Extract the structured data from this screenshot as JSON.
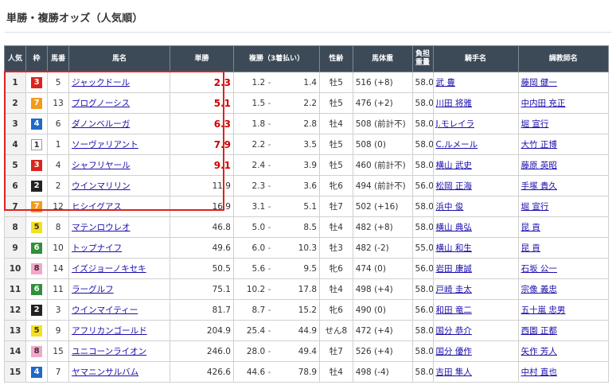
{
  "title": "単勝・複勝オッズ（人気順）",
  "columns": [
    "人気",
    "枠",
    "馬番",
    "馬名",
    "単勝",
    "複勝（3着払い）",
    "性齢",
    "馬体重",
    "負担重量",
    "騎手名",
    "調教師名"
  ],
  "waku_colors": {
    "1": {
      "bg": "#ffffff",
      "fg": "#333333"
    },
    "2": {
      "bg": "#222222",
      "fg": "#ffffff"
    },
    "3": {
      "bg": "#d9251c",
      "fg": "#ffffff"
    },
    "4": {
      "bg": "#1f6ac9",
      "fg": "#ffffff"
    },
    "5": {
      "bg": "#f5e020",
      "fg": "#333333"
    },
    "6": {
      "bg": "#2f8f3a",
      "fg": "#ffffff"
    },
    "7": {
      "bg": "#f39a1c",
      "fg": "#ffffff"
    },
    "8": {
      "bg": "#f4a6c8",
      "fg": "#333333"
    }
  },
  "highlight_color": "#e02020",
  "rows": [
    {
      "pop": "1",
      "waku": "3",
      "umaban": "5",
      "name": "ジャックドール",
      "win": "2.3",
      "win_red": true,
      "place_lo": "1.2",
      "place_hi": "1.4",
      "sexage": "牡5",
      "weight": "516 (+8)",
      "load": "58.0",
      "jockey": "武 豊",
      "trainer": "藤岡 健一"
    },
    {
      "pop": "2",
      "waku": "7",
      "umaban": "13",
      "name": "プログノーシス",
      "win": "5.1",
      "win_red": true,
      "place_lo": "1.5",
      "place_hi": "2.2",
      "sexage": "牡5",
      "weight": "476 (+2)",
      "load": "58.0",
      "jockey": "川田 将雅",
      "trainer": "中内田 充正"
    },
    {
      "pop": "3",
      "waku": "4",
      "umaban": "6",
      "name": "ダノンベルーガ",
      "win": "6.3",
      "win_red": true,
      "place_lo": "1.8",
      "place_hi": "2.8",
      "sexage": "牡4",
      "weight": "508 (前計不)",
      "load": "58.0",
      "jockey": "J.モレイラ",
      "trainer": "堀 宣行"
    },
    {
      "pop": "4",
      "waku": "1",
      "umaban": "1",
      "name": "ソーヴァリアント",
      "win": "7.9",
      "win_red": true,
      "place_lo": "2.2",
      "place_hi": "3.5",
      "sexage": "牡5",
      "weight": "508 (0)",
      "load": "58.0",
      "jockey": "C.ルメール",
      "trainer": "大竹 正博"
    },
    {
      "pop": "5",
      "waku": "3",
      "umaban": "4",
      "name": "シャフリヤール",
      "win": "9.1",
      "win_red": true,
      "place_lo": "2.4",
      "place_hi": "3.9",
      "sexage": "牡5",
      "weight": "460 (前計不)",
      "load": "58.0",
      "jockey": "横山 武史",
      "trainer": "藤原 英昭"
    },
    {
      "pop": "6",
      "waku": "2",
      "umaban": "2",
      "name": "ウインマリリン",
      "win": "11.9",
      "win_red": false,
      "place_lo": "2.3",
      "place_hi": "3.6",
      "sexage": "牝6",
      "weight": "494 (前計不)",
      "load": "56.0",
      "jockey": "松岡 正海",
      "trainer": "手塚 貴久"
    },
    {
      "pop": "7",
      "waku": "7",
      "umaban": "12",
      "name": "ヒシイグアス",
      "win": "16.9",
      "win_red": false,
      "place_lo": "3.1",
      "place_hi": "5.1",
      "sexage": "牡7",
      "weight": "502 (+16)",
      "load": "58.0",
      "jockey": "浜中 俊",
      "trainer": "堀 宣行"
    },
    {
      "pop": "8",
      "waku": "5",
      "umaban": "8",
      "name": "マテンロウレオ",
      "win": "46.8",
      "win_red": false,
      "place_lo": "5.0",
      "place_hi": "8.5",
      "sexage": "牡4",
      "weight": "482 (+8)",
      "load": "58.0",
      "jockey": "横山 典弘",
      "trainer": "昆 貢"
    },
    {
      "pop": "9",
      "waku": "6",
      "umaban": "10",
      "name": "トップナイフ",
      "win": "49.6",
      "win_red": false,
      "place_lo": "6.0",
      "place_hi": "10.3",
      "sexage": "牡3",
      "weight": "482 (-2)",
      "load": "55.0",
      "jockey": "横山 和生",
      "trainer": "昆 貢"
    },
    {
      "pop": "10",
      "waku": "8",
      "umaban": "14",
      "name": "イズジョーノキセキ",
      "win": "50.5",
      "win_red": false,
      "place_lo": "5.6",
      "place_hi": "9.5",
      "sexage": "牝6",
      "weight": "474 (0)",
      "load": "56.0",
      "jockey": "岩田 康誠",
      "trainer": "石坂 公一"
    },
    {
      "pop": "11",
      "waku": "6",
      "umaban": "11",
      "name": "ラーグルフ",
      "win": "75.1",
      "win_red": false,
      "place_lo": "10.2",
      "place_hi": "17.8",
      "sexage": "牡4",
      "weight": "498 (+4)",
      "load": "58.0",
      "jockey": "戸崎 圭太",
      "trainer": "宗像 義忠"
    },
    {
      "pop": "12",
      "waku": "2",
      "umaban": "3",
      "name": "ウインマイティー",
      "win": "81.7",
      "win_red": false,
      "place_lo": "8.7",
      "place_hi": "15.2",
      "sexage": "牝6",
      "weight": "490 (0)",
      "load": "56.0",
      "jockey": "和田 竜二",
      "trainer": "五十嵐 忠男"
    },
    {
      "pop": "13",
      "waku": "5",
      "umaban": "9",
      "name": "アフリカンゴールド",
      "win": "204.9",
      "win_red": false,
      "place_lo": "25.4",
      "place_hi": "44.9",
      "sexage": "せん8",
      "weight": "472 (+4)",
      "load": "58.0",
      "jockey": "国分 恭介",
      "trainer": "西園 正都"
    },
    {
      "pop": "14",
      "waku": "8",
      "umaban": "15",
      "name": "ユニコーンライオン",
      "win": "246.0",
      "win_red": false,
      "place_lo": "28.0",
      "place_hi": "49.4",
      "sexage": "牡7",
      "weight": "526 (+4)",
      "load": "58.0",
      "jockey": "国分 優作",
      "trainer": "矢作 芳人"
    },
    {
      "pop": "15",
      "waku": "4",
      "umaban": "7",
      "name": "ヤマニンサルバム",
      "win": "426.6",
      "win_red": false,
      "place_lo": "44.6",
      "place_hi": "78.9",
      "sexage": "牡4",
      "weight": "498 (-4)",
      "load": "58.0",
      "jockey": "吉田 隼人",
      "trainer": "中村 直也"
    }
  ]
}
